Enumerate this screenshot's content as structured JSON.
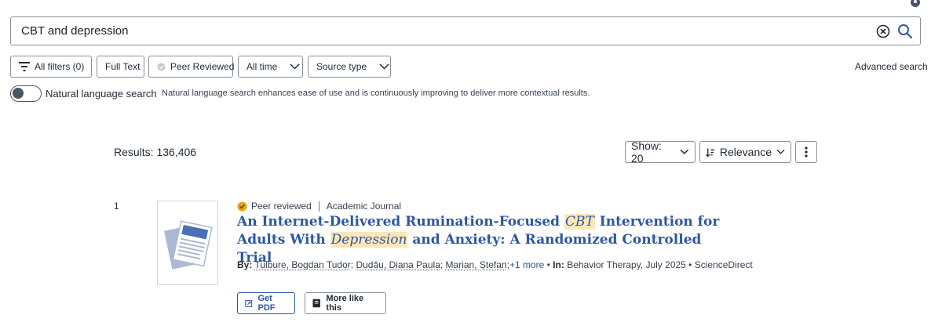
{
  "search": {
    "query": "CBT and depression"
  },
  "filters": {
    "all_filters": "All filters (0)",
    "full_text": "Full Text",
    "peer_reviewed": "Peer Reviewed",
    "all_time": "All time",
    "source_type": "Source type",
    "advanced_search": "Advanced search"
  },
  "natural_language": {
    "label": "Natural language search",
    "description": "Natural language search enhances ease of use and is continuously improving to deliver more contextual results."
  },
  "results": {
    "count_text": "Results: 136,406",
    "show": "Show: 20",
    "sort": "Relevance"
  },
  "result_1": {
    "number": "1",
    "peer_reviewed": "Peer reviewed",
    "type": "Academic Journal",
    "title_part1": "An Internet-Delivered Rumination-Focused ",
    "title_hl1": "CBT",
    "title_part2": " Intervention for Adults With ",
    "title_hl2": "Depression",
    "title_part3": " and Anxiety: A Randomized Controlled Trial",
    "by_label": "By:",
    "author_1": "Tulbure, Bogdan Tudor",
    "author_2": "Dudău, Diana Paula",
    "author_3": "Marian, Ștefan",
    "more_authors": "+1 more",
    "in_label": "In:",
    "source": "Behavior Therapy, July 2025",
    "provider": "ScienceDirect",
    "get_pdf": "Get PDF",
    "more_like_this": "More like this"
  },
  "colors": {
    "link": "#2b57a8",
    "highlight": "#fbe6b8",
    "badge": "#e8a317"
  }
}
